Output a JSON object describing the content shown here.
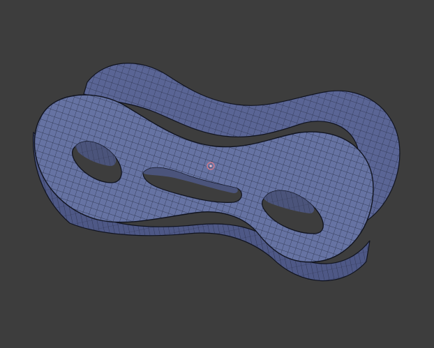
{
  "viewport": {
    "background_color": "#3d3d3d",
    "mesh_face_color": "#6673a3",
    "mesh_side_color": "#56608d",
    "mesh_edge_color": "#141827",
    "origin_marker_color": "#d07a8c"
  }
}
